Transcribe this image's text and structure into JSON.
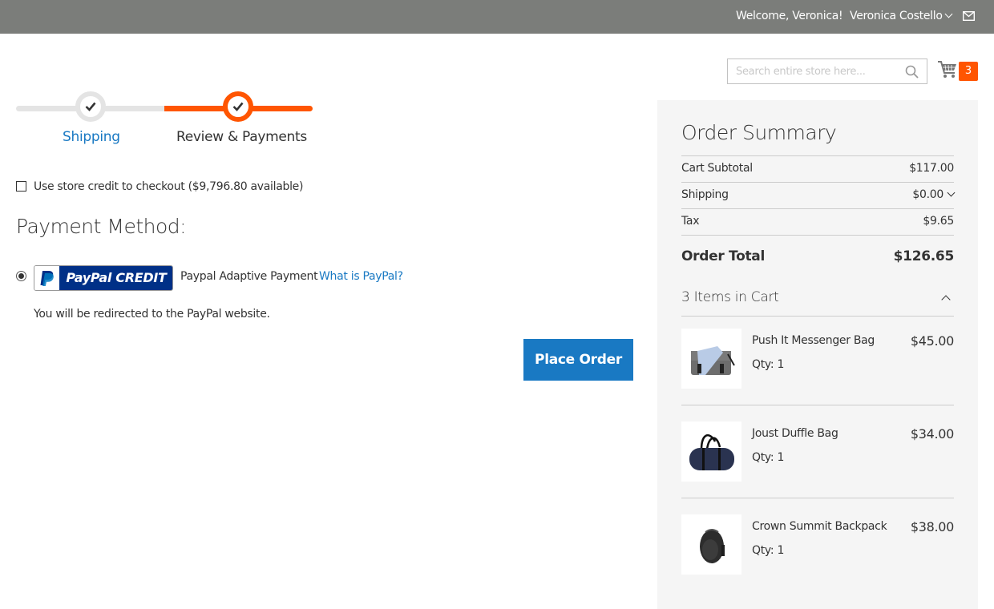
{
  "header": {
    "welcome": "Welcome, Veronica!",
    "account_name": "Veronica Costello",
    "icons": {
      "account_dropdown": "chevron-down-icon",
      "mail": "mail-icon"
    }
  },
  "search": {
    "placeholder": "Search entire store here...",
    "value": "",
    "icon": "search-icon"
  },
  "cart": {
    "icon": "cart-icon",
    "count": "3"
  },
  "progress": {
    "steps": [
      {
        "label": "Shipping",
        "state": "complete"
      },
      {
        "label": "Review & Payments",
        "state": "active"
      }
    ],
    "colors": {
      "active": "#ff5501",
      "inactive": "#e4e4e4",
      "link": "#1979c3"
    }
  },
  "store_credit": {
    "label": "Use store credit to checkout ($9,796.80 available)",
    "checked": false
  },
  "payment": {
    "title": "Payment Method:",
    "method": {
      "selected": true,
      "logo_text": "PayPal CREDIT",
      "name": "Paypal Adaptive Payment",
      "link": "What is PayPal?",
      "note": "You will be redirected to the PayPal website."
    },
    "place_order_label": "Place Order",
    "button_color": "#1979c3"
  },
  "summary": {
    "title": "Order Summary",
    "rows": [
      {
        "label": "Cart Subtotal",
        "value": "$117.00"
      },
      {
        "label": "Shipping",
        "value": "$0.00"
      },
      {
        "label": "Tax",
        "value": "$9.65"
      }
    ],
    "total": {
      "label": "Order Total",
      "value": "$126.65"
    },
    "items_header": "3 Items in Cart",
    "items": [
      {
        "name": "Push It Messenger Bag",
        "qty": "Qty: 1",
        "price": "$45.00",
        "image": "messenger-bag-image"
      },
      {
        "name": "Joust Duffle Bag",
        "qty": "Qty: 1",
        "price": "$34.00",
        "image": "duffle-bag-image"
      },
      {
        "name": "Crown Summit Backpack",
        "qty": "Qty: 1",
        "price": "$38.00",
        "image": "backpack-image"
      }
    ]
  }
}
